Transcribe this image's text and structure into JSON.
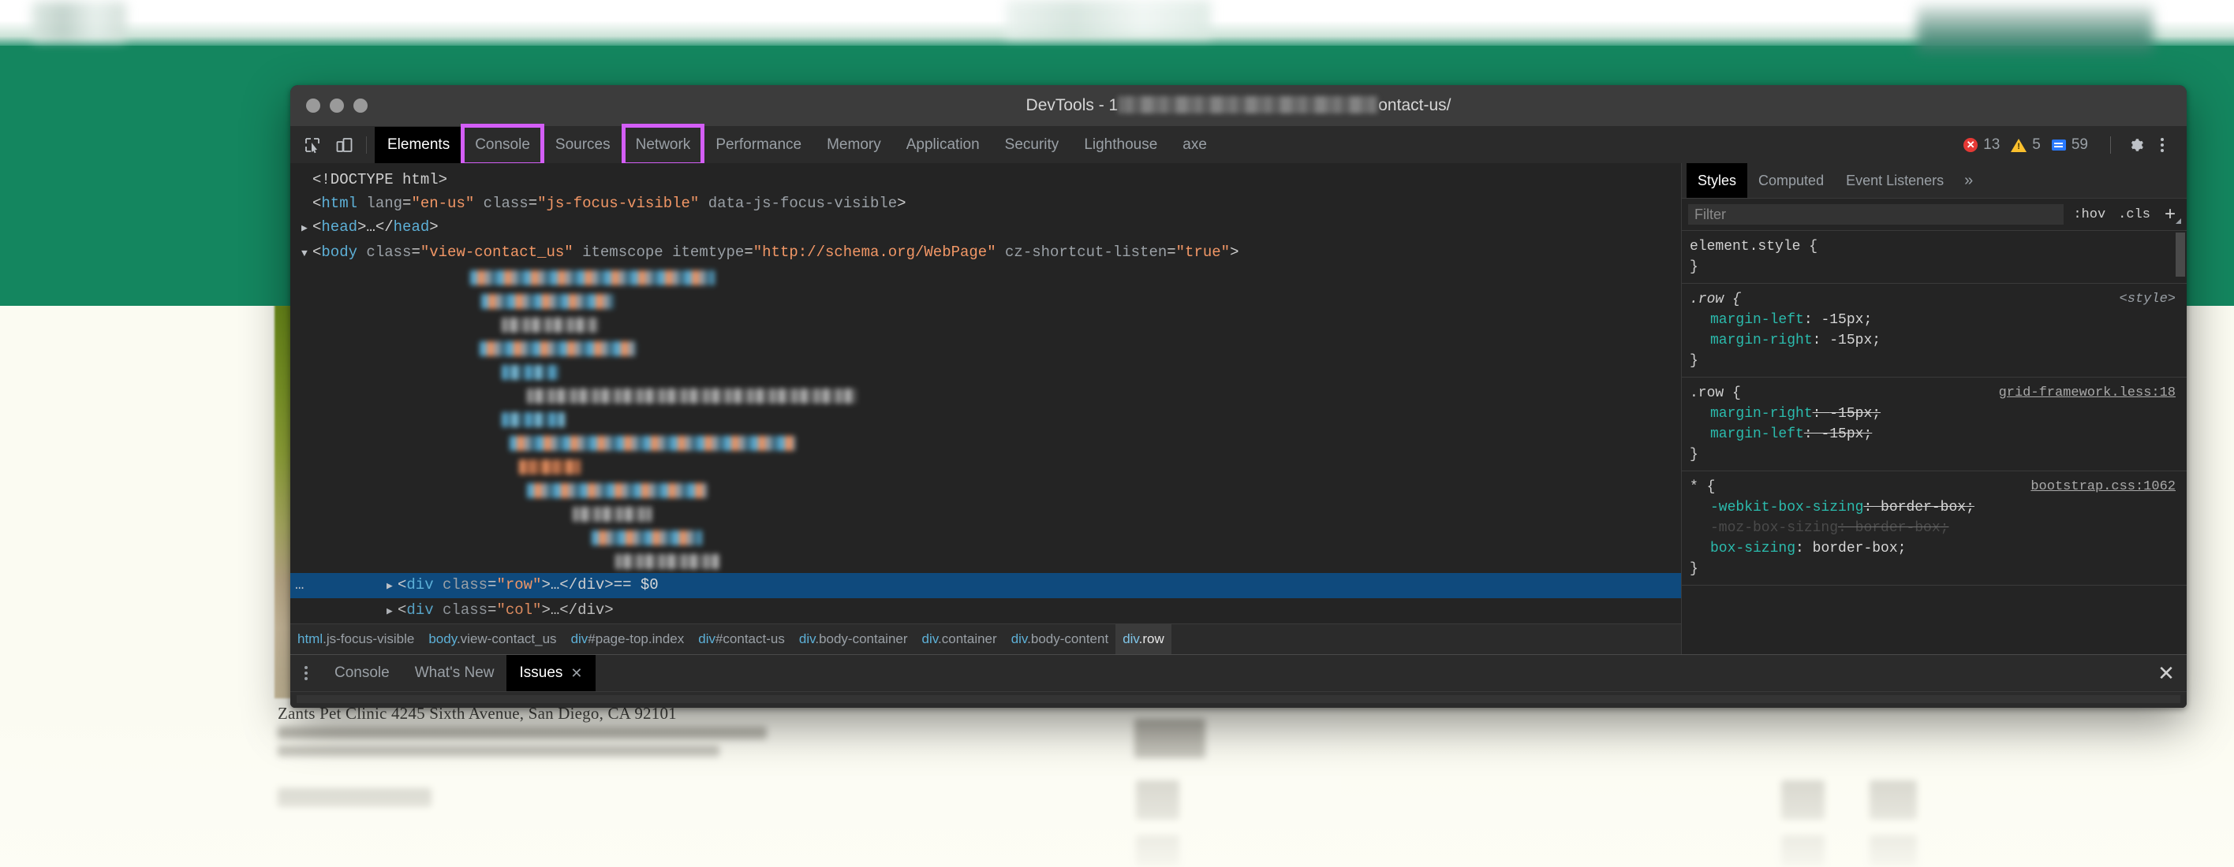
{
  "background_page": {
    "visible_heading": "Zants Pet Clinic 4245 Sixth Avenue, San Diego, CA 92101",
    "brand_color": "#14865f",
    "page_background": "#fdfdf5"
  },
  "window": {
    "title_prefix": "DevTools - 1",
    "title_suffix": "ontact-us/",
    "traffic_lights": [
      "close-button",
      "minimize-button",
      "zoom-button"
    ]
  },
  "main_toolbar": {
    "left_icons": [
      {
        "name": "inspect-element-icon",
        "label": "Inspect element"
      },
      {
        "name": "device-toolbar-icon",
        "label": "Toggle device toolbar"
      }
    ],
    "tabs": [
      {
        "label": "Elements",
        "active": true,
        "highlighted": false
      },
      {
        "label": "Console",
        "active": false,
        "highlighted": true
      },
      {
        "label": "Sources",
        "active": false,
        "highlighted": false
      },
      {
        "label": "Network",
        "active": false,
        "highlighted": true
      },
      {
        "label": "Performance",
        "active": false,
        "highlighted": false
      },
      {
        "label": "Memory",
        "active": false,
        "highlighted": false
      },
      {
        "label": "Application",
        "active": false,
        "highlighted": false
      },
      {
        "label": "Security",
        "active": false,
        "highlighted": false
      },
      {
        "label": "Lighthouse",
        "active": false,
        "highlighted": false
      },
      {
        "label": "axe",
        "active": false,
        "highlighted": false
      }
    ],
    "highlight_color": "#d45ef7",
    "counters": {
      "errors": "13",
      "warnings": "5",
      "info": "59"
    },
    "right_icons": [
      {
        "name": "gear-icon",
        "label": "Settings"
      },
      {
        "name": "kebab-menu-icon",
        "label": "Customize and control DevTools"
      }
    ]
  },
  "dom_tree": {
    "lines": [
      {
        "type": "text",
        "indent": 0,
        "twisty": "",
        "content": "doctype"
      },
      {
        "type": "html",
        "indent": 0,
        "twisty": "",
        "content": "html-open"
      },
      {
        "type": "head",
        "indent": 1,
        "twisty": "▶",
        "content": "head-collapsed"
      },
      {
        "type": "body",
        "indent": 1,
        "twisty": "▼",
        "content": "body-open"
      }
    ],
    "doctype": "<!DOCTYPE html>",
    "html_tag": "html",
    "html_attrs": [
      {
        "name": "lang",
        "value": "en-us"
      },
      {
        "name": "class",
        "value": "js-focus-visible"
      },
      {
        "name": "data-js-focus-visible",
        "value": null
      }
    ],
    "head_line": "<head>…</head>",
    "body_tag": "body",
    "body_attrs": [
      {
        "name": "class",
        "value": "view-contact_us"
      },
      {
        "name": "itemscope",
        "value": null
      },
      {
        "name": "itemtype",
        "value": "http://schema.org/WebPage"
      },
      {
        "name": "cz-shortcut-listen",
        "value": "true"
      }
    ],
    "selected_line": "<div class=\"row\">…</div> == $0",
    "selected_div_class": "row",
    "selected_marker": "== $0",
    "next_line_partial": "<div class=\"col\">…</div>"
  },
  "breadcrumb": {
    "items": [
      {
        "tag": "html",
        "rest": ".js-focus-visible",
        "selected": false
      },
      {
        "tag": "body",
        "rest": ".view-contact_us",
        "selected": false
      },
      {
        "tag": "div",
        "rest": "#page-top.index",
        "selected": false
      },
      {
        "tag": "div",
        "rest": "#contact-us",
        "selected": false
      },
      {
        "tag": "div",
        "rest": ".body-container",
        "selected": false
      },
      {
        "tag": "div",
        "rest": ".container",
        "selected": false
      },
      {
        "tag": "div",
        "rest": ".body-content",
        "selected": false
      },
      {
        "tag": "div",
        "rest": ".row",
        "selected": true
      }
    ]
  },
  "styles_panel": {
    "tabs": [
      {
        "label": "Styles",
        "active": true
      },
      {
        "label": "Computed",
        "active": false
      },
      {
        "label": "Event Listeners",
        "active": false
      },
      {
        "label": "»",
        "active": false
      }
    ],
    "filter_placeholder": "Filter",
    "filter_value": "",
    "toggles": [
      {
        "label": ":hov"
      },
      {
        "label": ".cls"
      },
      {
        "label": "+"
      }
    ],
    "rules": [
      {
        "selector": "element.style",
        "origin": "",
        "origin_kind": "none",
        "declarations": []
      },
      {
        "selector": ".row",
        "origin": "<style>",
        "origin_kind": "style",
        "declarations": [
          {
            "property": "margin-left",
            "value": "-15px",
            "state": "active"
          },
          {
            "property": "margin-right",
            "value": "-15px",
            "state": "active"
          }
        ]
      },
      {
        "selector": ".row",
        "origin": "grid-framework.less:18",
        "origin_kind": "link",
        "declarations": [
          {
            "property": "margin-right",
            "value": "-15px",
            "state": "overridden"
          },
          {
            "property": "margin-left",
            "value": "-15px",
            "state": "overridden"
          }
        ]
      },
      {
        "selector": "*",
        "origin": "bootstrap.css:1062",
        "origin_kind": "link",
        "declarations": [
          {
            "property": "-webkit-box-sizing",
            "value": "border-box",
            "state": "overridden"
          },
          {
            "property": "-moz-box-sizing",
            "value": "border-box",
            "state": "disabled"
          },
          {
            "property": "box-sizing",
            "value": "border-box",
            "state": "active"
          }
        ]
      }
    ]
  },
  "drawer": {
    "menu_icon": "kebab-menu-icon",
    "tabs": [
      {
        "label": "Console",
        "active": false,
        "closable": false
      },
      {
        "label": "What's New",
        "active": false,
        "closable": false
      },
      {
        "label": "Issues",
        "active": true,
        "closable": true
      }
    ],
    "close_label": "✕"
  }
}
